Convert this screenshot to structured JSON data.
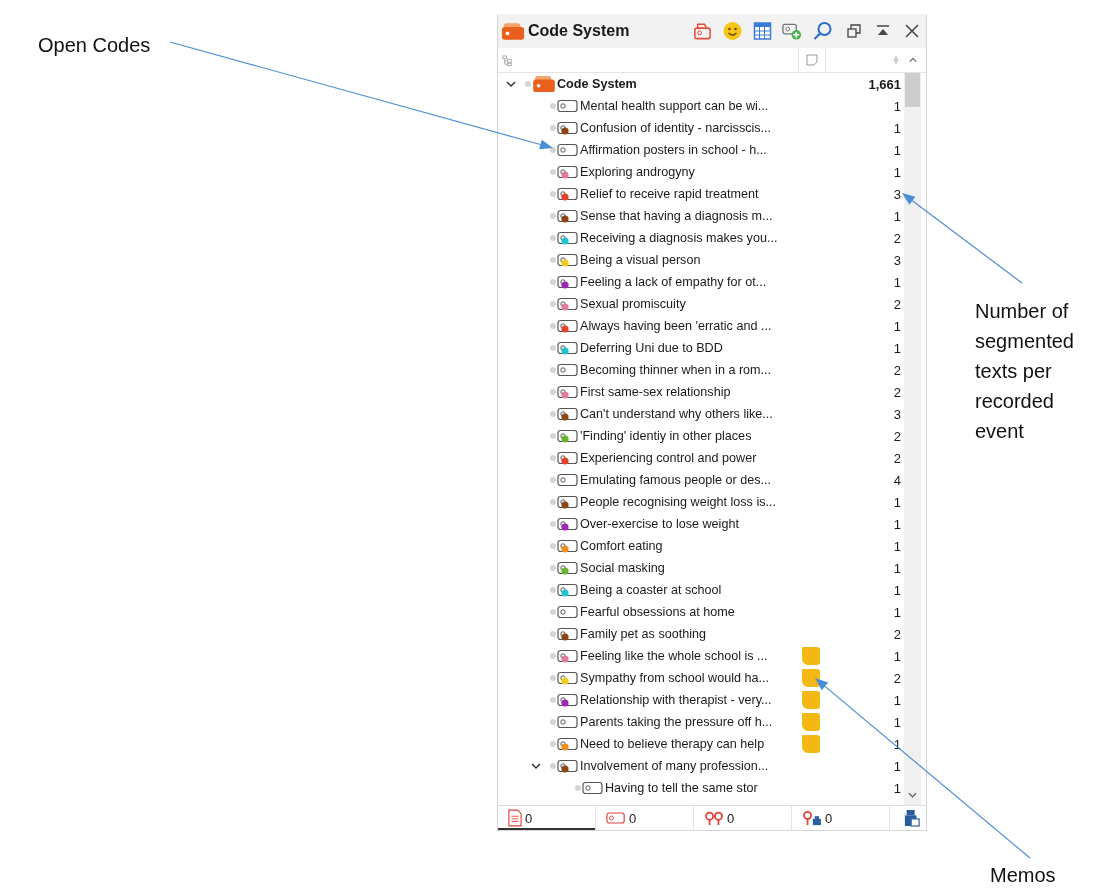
{
  "annotations": {
    "open_codes": "Open Codes",
    "counts": "Number of segmented texts per recorded event",
    "memos": "Memos"
  },
  "panel": {
    "title": "Code System"
  },
  "tree": [
    {
      "label": "Code System",
      "count": "1,661",
      "expanded": true,
      "memo": false,
      "kind": "root",
      "children": [
        {
          "label": "Mental health support can be wi...",
          "count": "1",
          "expanded": false,
          "memo": false
        },
        {
          "label": "Confusion of identity - narcisscis...",
          "count": "1",
          "expanded": false,
          "memo": false,
          "color": "#8b4513"
        },
        {
          "label": "Affirmation posters in school - h...",
          "count": "1",
          "expanded": false,
          "memo": false
        },
        {
          "label": "Exploring androgyny",
          "count": "1",
          "expanded": false,
          "memo": false,
          "color": "#e07aa0"
        },
        {
          "label": "Relief to receive rapid treatment",
          "count": "3",
          "expanded": false,
          "memo": false,
          "color": "#e8402a"
        },
        {
          "label": "Sense that having a diagnosis m...",
          "count": "1",
          "expanded": false,
          "memo": false,
          "color": "#8b4513"
        },
        {
          "label": "Receiving a diagnosis makes you...",
          "count": "2",
          "expanded": false,
          "memo": false,
          "color": "#1fc4d0"
        },
        {
          "label": "Being a visual person",
          "count": "3",
          "expanded": false,
          "memo": false,
          "color": "#f2cc1a"
        },
        {
          "label": "Feeling a lack of empathy for ot...",
          "count": "1",
          "expanded": false,
          "memo": false,
          "color": "#9c27b0"
        },
        {
          "label": "Sexual promiscuity",
          "count": "2",
          "expanded": false,
          "memo": false,
          "color": "#e07aa0"
        },
        {
          "label": "Always having been 'erratic and ...",
          "count": "1",
          "expanded": false,
          "memo": false,
          "color": "#e8402a"
        },
        {
          "label": "Deferring Uni due to BDD",
          "count": "1",
          "expanded": false,
          "memo": false,
          "color": "#1fc4d0"
        },
        {
          "label": "Becoming thinner when in a rom...",
          "count": "2",
          "expanded": false,
          "memo": false
        },
        {
          "label": "First same-sex relationship",
          "count": "2",
          "expanded": false,
          "memo": false,
          "color": "#e07aa0"
        },
        {
          "label": "Can't understand why others like...",
          "count": "3",
          "expanded": false,
          "memo": false,
          "color": "#8b4513"
        },
        {
          "label": "'Finding' identiy in other places",
          "count": "2",
          "expanded": false,
          "memo": false,
          "color": "#6ab42d"
        },
        {
          "label": "Experiencing control and power",
          "count": "2",
          "expanded": false,
          "memo": false,
          "color": "#e8402a"
        },
        {
          "label": "Emulating famous people or des...",
          "count": "4",
          "expanded": false,
          "memo": false
        },
        {
          "label": "People recognising weight loss is...",
          "count": "1",
          "expanded": false,
          "memo": false,
          "color": "#8b4513"
        },
        {
          "label": "Over-exercise to lose weight",
          "count": "1",
          "expanded": false,
          "memo": false,
          "color": "#9c27b0"
        },
        {
          "label": "Comfort eating",
          "count": "1",
          "expanded": false,
          "memo": false,
          "color": "#f28c1c"
        },
        {
          "label": "Social masking",
          "count": "1",
          "expanded": false,
          "memo": false,
          "color": "#6ab42d"
        },
        {
          "label": "Being a coaster at school",
          "count": "1",
          "expanded": false,
          "memo": false,
          "color": "#1fc4d0"
        },
        {
          "label": "Fearful obsessions at home",
          "count": "1",
          "expanded": false,
          "memo": false
        },
        {
          "label": "Family pet as soothing",
          "count": "2",
          "expanded": false,
          "memo": false,
          "color": "#8b4513"
        },
        {
          "label": "Feeling like the whole school is ...",
          "count": "1",
          "expanded": false,
          "memo": true,
          "color": "#e07aa0"
        },
        {
          "label": "Sympathy from school would ha...",
          "count": "2",
          "expanded": false,
          "memo": true,
          "color": "#f2cc1a"
        },
        {
          "label": "Relationship with therapist - very...",
          "count": "1",
          "expanded": false,
          "memo": true,
          "color": "#9c27b0"
        },
        {
          "label": "Parents taking the pressure off h...",
          "count": "1",
          "expanded": false,
          "memo": true
        },
        {
          "label": "Need to believe therapy can help",
          "count": "1",
          "expanded": false,
          "memo": true,
          "color": "#f28c1c"
        },
        {
          "label": "Involvement of many profession...",
          "count": "1",
          "expanded": true,
          "memo": false,
          "color": "#8b4513",
          "children": [
            {
              "label": "Having to tell the same stor",
              "count": "1",
              "expanded": false,
              "memo": false
            }
          ]
        }
      ]
    }
  ],
  "footer_tabs": [
    {
      "kind": "documents",
      "count": "0",
      "selected": true
    },
    {
      "kind": "codes",
      "count": "0",
      "selected": false
    },
    {
      "kind": "links",
      "count": "0",
      "selected": false
    },
    {
      "kind": "variables",
      "count": "0",
      "selected": false
    }
  ]
}
